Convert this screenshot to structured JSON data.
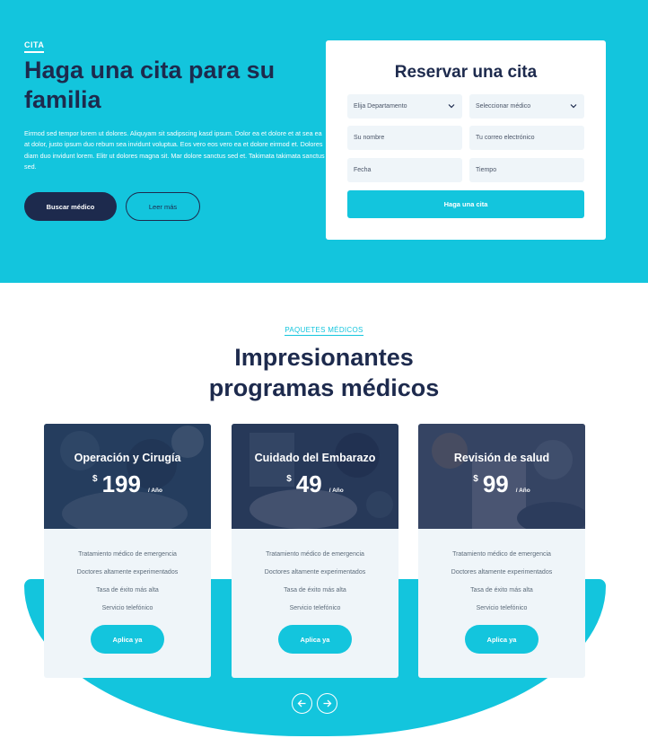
{
  "hero": {
    "eyebrow": "CITA",
    "title": "Haga una cita para su familia",
    "text": "Eirmod sed tempor lorem ut dolores. Aliquyam sit sadipscing kasd ipsum. Dolor ea et dolore et at sea ea at dolor, justo ipsum duo rebum sea invidunt voluptua. Eos vero eos vero ea et dolore eirmod et. Dolores diam duo invidunt lorem. Elitr ut dolores magna sit. Mar dolore sanctus sed et. Takimata takimata sanctus sed.",
    "primary_button": "Buscar médico",
    "secondary_button": "Leer más"
  },
  "form": {
    "title": "Reservar una cita",
    "department_select": "Elija Departamento",
    "doctor_select": "Seleccionar médico",
    "name_placeholder": "Su nombre",
    "email_placeholder": "Tu correo electrónico",
    "date_placeholder": "Fecha",
    "time_placeholder": "Tiempo",
    "submit": "Haga una cita"
  },
  "packages": {
    "eyebrow": "PAQUETES MÉDICOS",
    "title_line1": "Impresionantes",
    "title_line2": "programas médicos",
    "cards": [
      {
        "name": "Operación y Cirugía",
        "currency": "$",
        "price": "199",
        "period": "/ Año",
        "features": [
          "Tratamiento médico de emergencia",
          "Doctores altamente experimentados",
          "Tasa de éxito más alta",
          "Servicio telefónico"
        ],
        "button": "Aplica ya"
      },
      {
        "name": "Cuidado del Embarazo",
        "currency": "$",
        "price": "49",
        "period": "/ Año",
        "features": [
          "Tratamiento médico de emergencia",
          "Doctores altamente experimentados",
          "Tasa de éxito más alta",
          "Servicio telefónico"
        ],
        "button": "Aplica ya"
      },
      {
        "name": "Revisión de salud",
        "currency": "$",
        "price": "99",
        "period": "/ Año",
        "features": [
          "Tratamiento médico de emergencia",
          "Doctores altamente experimentados",
          "Tasa de éxito más alta",
          "Servicio telefónico"
        ],
        "button": "Aplica ya"
      }
    ]
  },
  "icons": {
    "select_chevron": "chevron-down-icon",
    "prev": "arrow-left-icon",
    "next": "arrow-right-icon"
  },
  "colors": {
    "brand_cyan": "#13c5dd",
    "brand_navy": "#1d2a4d",
    "light_bg": "#eff5f9"
  }
}
